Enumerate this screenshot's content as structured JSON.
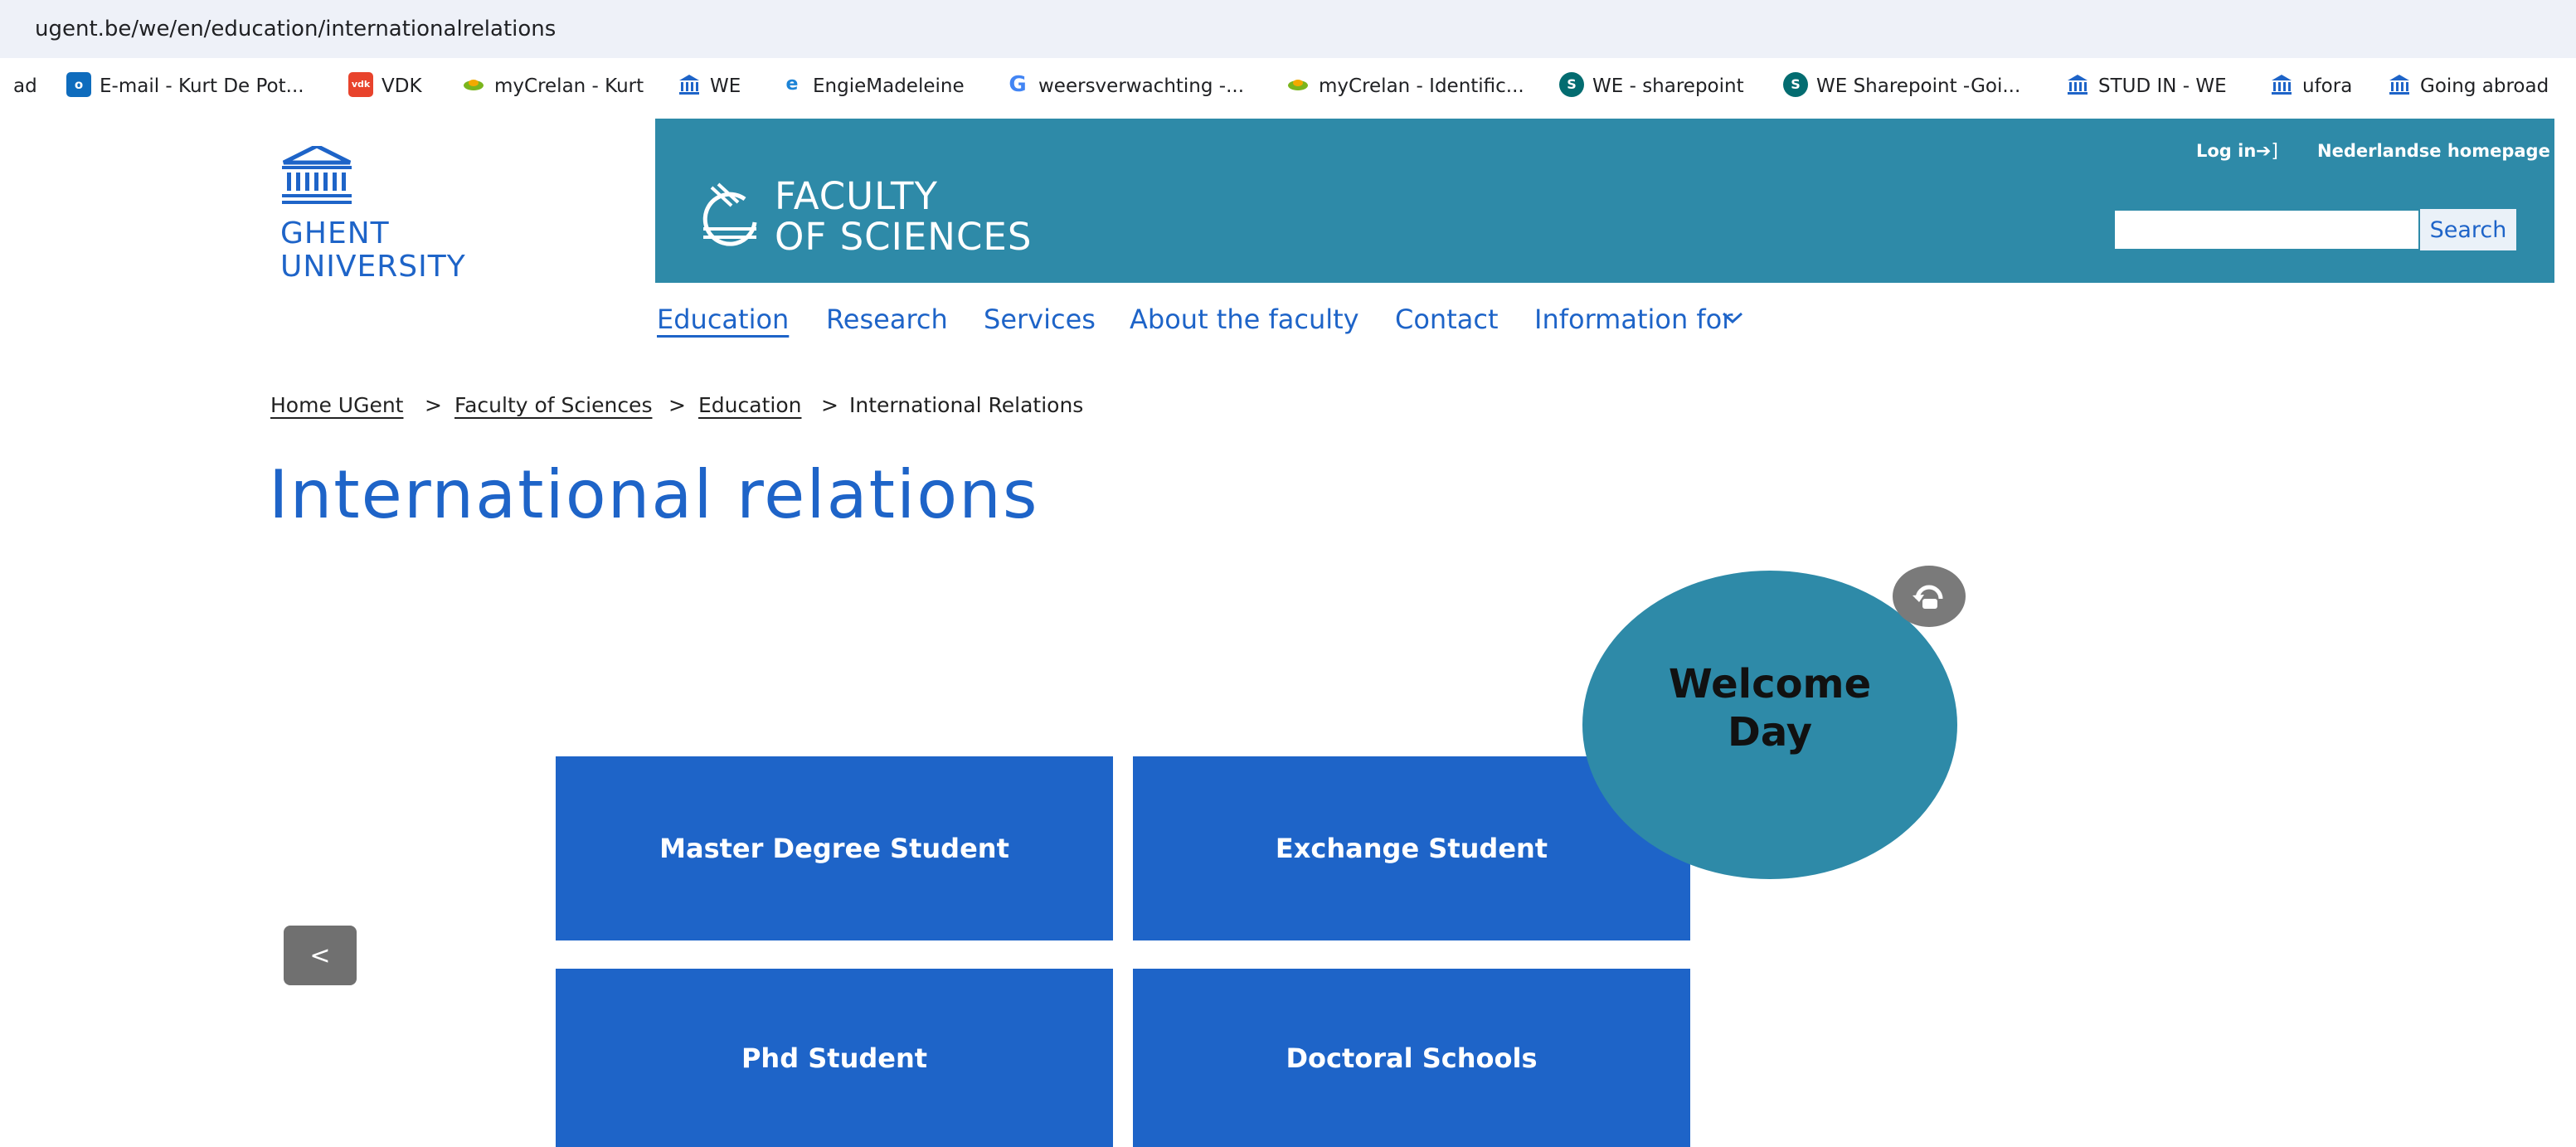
{
  "browser": {
    "url": "ugent.be/we/en/education/internationalrelations",
    "bookmarks": [
      {
        "label": "ad",
        "icon": "none"
      },
      {
        "label": "E-mail - Kurt De Pot...",
        "icon": "outlook-icon"
      },
      {
        "label": "VDK",
        "icon": "vdk-icon"
      },
      {
        "label": "myCrelan - Kurt",
        "icon": "crelan-leaf-icon"
      },
      {
        "label": "WE",
        "icon": "ugent-building-icon"
      },
      {
        "label": "EngieMadeleine",
        "icon": "edge-icon"
      },
      {
        "label": "weersverwachting -...",
        "icon": "google-icon"
      },
      {
        "label": "myCrelan - Identific...",
        "icon": "crelan-leaf-icon"
      },
      {
        "label": "WE - sharepoint",
        "icon": "sharepoint-icon"
      },
      {
        "label": "WE Sharepoint -Goi...",
        "icon": "sharepoint-icon"
      },
      {
        "label": "STUD IN - WE",
        "icon": "ugent-building-icon"
      },
      {
        "label": "ufora",
        "icon": "ugent-building-icon"
      },
      {
        "label": "Going abroad",
        "icon": "ugent-building-icon"
      }
    ]
  },
  "header": {
    "university": "GHENT\nUNIVERSITY",
    "faculty": "FACULTY\nOF SCIENCES",
    "login_label": "Log in",
    "dutch_home_label": "Nederlandse homepage",
    "search_value": "",
    "search_button_label": "Search"
  },
  "nav": {
    "items": [
      "Education",
      "Research",
      "Services",
      "About the faculty",
      "Contact",
      "Information for"
    ],
    "active": "Education"
  },
  "breadcrumb": {
    "items": [
      "Home UGent",
      "Faculty of Sciences",
      "Education",
      "International Relations"
    ],
    "separator": ">"
  },
  "page": {
    "title": "International relations"
  },
  "tiles": {
    "master": "Master Degree Student",
    "exchange": "Exchange Student",
    "phd": "Phd Student",
    "doctoral": "Doctoral Schools",
    "welcome": "Welcome\nDay"
  },
  "controls": {
    "prev_label": "<"
  },
  "colors": {
    "ugent_blue": "#1e64c8",
    "faculty_teal": "#2e8aa8",
    "tile_blue": "#1e64c8",
    "welcome_teal": "#2e8aa8"
  }
}
